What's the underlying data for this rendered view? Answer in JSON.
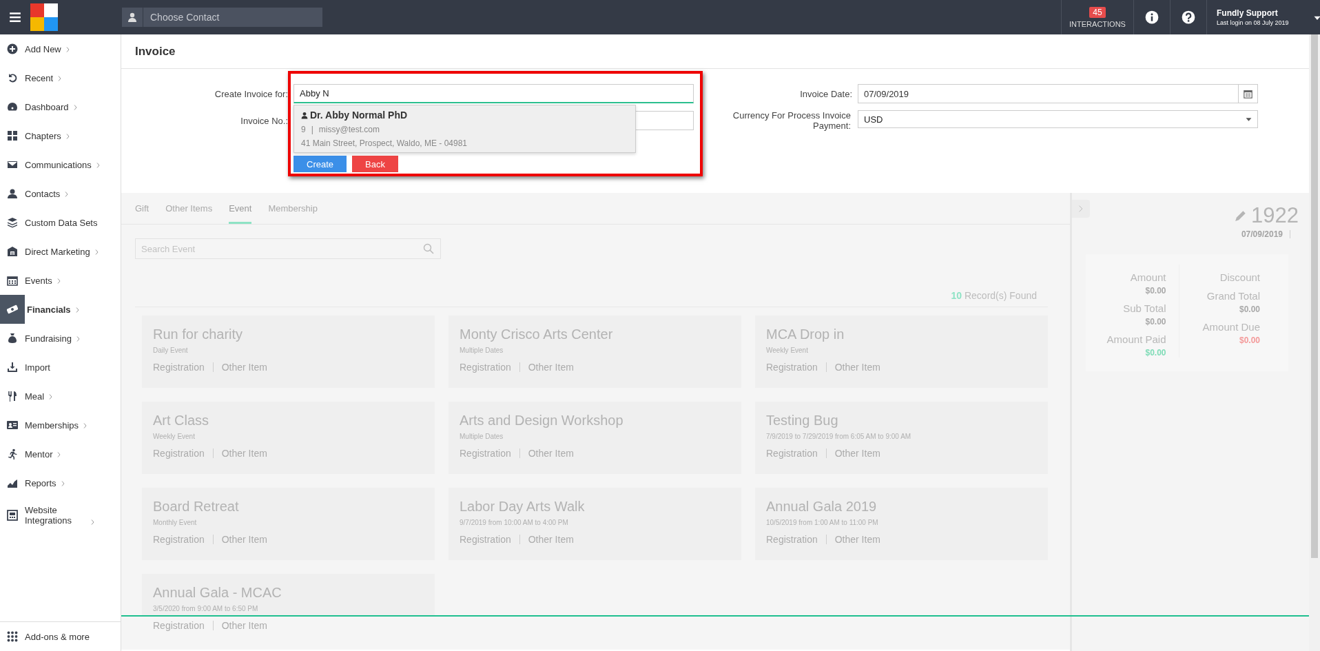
{
  "topbar": {
    "contact_search": {
      "placeholder": "Choose Contact"
    },
    "interactions": {
      "count": "45",
      "label": "INTERACTIONS"
    },
    "user": {
      "name": "Fundly Support",
      "last_login": "Last login on 08 July 2019"
    }
  },
  "sidebar": {
    "items": [
      {
        "label": "Add New",
        "expandable": true,
        "selected": false
      },
      {
        "label": "Recent",
        "expandable": true,
        "selected": false
      },
      {
        "label": "Dashboard",
        "expandable": true,
        "selected": false
      },
      {
        "label": "Chapters",
        "expandable": true,
        "selected": false
      },
      {
        "label": "Communications",
        "expandable": true,
        "selected": false
      },
      {
        "label": "Contacts",
        "expandable": true,
        "selected": false
      },
      {
        "label": "Custom Data Sets",
        "expandable": false,
        "selected": false
      },
      {
        "label": "Direct Marketing",
        "expandable": true,
        "selected": false
      },
      {
        "label": "Events",
        "expandable": true,
        "selected": false
      },
      {
        "label": "Financials",
        "expandable": true,
        "selected": true
      },
      {
        "label": "Fundraising",
        "expandable": true,
        "selected": false
      },
      {
        "label": "Import",
        "expandable": false,
        "selected": false
      },
      {
        "label": "Meal",
        "expandable": true,
        "selected": false
      },
      {
        "label": "Memberships",
        "expandable": true,
        "selected": false
      },
      {
        "label": "Mentor",
        "expandable": true,
        "selected": false
      },
      {
        "label": "Reports",
        "expandable": true,
        "selected": false
      },
      {
        "label": "Website Integrations",
        "expandable": true,
        "selected": false
      }
    ],
    "footer": {
      "label": "Add-ons & more"
    }
  },
  "page_title": "Invoice",
  "form": {
    "create_for": {
      "label": "Create Invoice for:",
      "value": "Abby N"
    },
    "invoice_no": {
      "label": "Invoice No.:"
    },
    "invoice_date": {
      "label": "Invoice Date:",
      "value": "07/09/2019"
    },
    "currency": {
      "label": "Currency For Process Invoice Payment:",
      "value": "USD"
    },
    "buttons": [
      {
        "label": "Create",
        "kind": "primary"
      },
      {
        "label": "Back",
        "kind": "danger"
      }
    ],
    "suggestion": {
      "name": "Dr. Abby Normal PhD",
      "id": "9",
      "separator": "|",
      "email": "missy@test.com",
      "address": "41 Main Street, Prospect, Waldo, ME - 04981"
    }
  },
  "tabs": [
    {
      "label": "Gift",
      "selected": false
    },
    {
      "label": "Other Items",
      "selected": false
    },
    {
      "label": "Event",
      "selected": true
    },
    {
      "label": "Membership",
      "selected": false
    }
  ],
  "event_search": {
    "placeholder": "Search Event"
  },
  "records": {
    "count": "10",
    "label": "Record(s) Found"
  },
  "events": [
    {
      "title": "Run for charity",
      "subtitle": "Daily Event",
      "links": [
        "Registration",
        "Other Item"
      ]
    },
    {
      "title": "Monty Crisco Arts Center",
      "subtitle": "Multiple Dates",
      "links": [
        "Registration",
        "Other Item"
      ]
    },
    {
      "title": "MCA Drop in",
      "subtitle": "Weekly Event",
      "links": [
        "Registration",
        "Other Item"
      ]
    },
    {
      "title": "Art Class",
      "subtitle": "Weekly Event",
      "links": [
        "Registration",
        "Other Item"
      ]
    },
    {
      "title": "Arts and Design Workshop",
      "subtitle": "Multiple Dates",
      "links": [
        "Registration",
        "Other Item"
      ]
    },
    {
      "title": "Testing Bug",
      "subtitle": "7/9/2019 to 7/29/2019 from 6:05 AM to 9:00 AM",
      "links": [
        "Registration",
        "Other Item"
      ]
    },
    {
      "title": "Board Retreat",
      "subtitle": "Monthly Event",
      "links": [
        "Registration",
        "Other Item"
      ]
    },
    {
      "title": "Labor Day Arts Walk",
      "subtitle": "9/7/2019 from 10:00 AM to 4:00 PM",
      "links": [
        "Registration",
        "Other Item"
      ]
    },
    {
      "title": "Annual Gala 2019",
      "subtitle": "10/5/2019 from 1:00 AM to 11:00 PM",
      "links": [
        "Registration",
        "Other Item"
      ]
    },
    {
      "title": "Annual Gala - MCAC",
      "subtitle": "3/5/2020 from 9:00 AM to 6:50 PM",
      "links": [
        "Registration",
        "Other Item"
      ]
    }
  ],
  "summary": {
    "number": "1922",
    "date": "07/09/2019",
    "columns": [
      [
        {
          "label": "Amount",
          "value": "$0.00",
          "color": "#a9a9a9"
        },
        {
          "label": "Sub Total",
          "value": "$0.00",
          "color": "#a9a9a9"
        },
        {
          "label": "Amount Paid",
          "value": "$0.00",
          "color": "#7fdcb7"
        }
      ],
      [
        {
          "label": "Discount"
        },
        {
          "label": "Grand Total",
          "value": "$0.00",
          "color": "#a9a9a9"
        },
        {
          "label": "Amount Due",
          "value": "$0.00",
          "color": "#f49a9a"
        }
      ]
    ]
  }
}
